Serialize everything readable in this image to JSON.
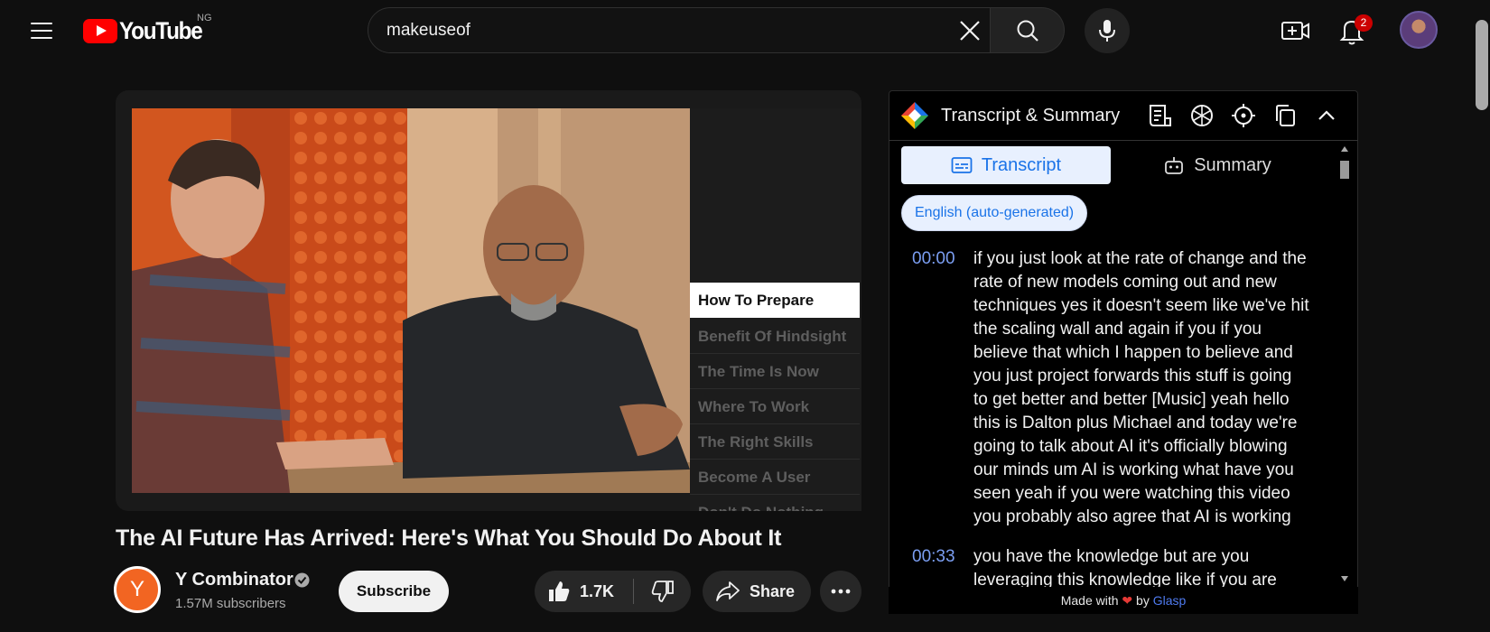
{
  "topbar": {
    "logo_text": "YouTube",
    "country_code": "NG",
    "search_value": "makeuseof",
    "notification_count": "2"
  },
  "video": {
    "title": "The AI Future Has Arrived: Here's What You Should Do About It",
    "chapters": [
      {
        "label": "How To Prepare",
        "active": true
      },
      {
        "label": "Benefit Of Hindsight",
        "active": false
      },
      {
        "label": "The Time Is Now",
        "active": false
      },
      {
        "label": "Where To Work",
        "active": false
      },
      {
        "label": "The Right Skills",
        "active": false
      },
      {
        "label": "Become A User",
        "active": false
      },
      {
        "label": "Don't Do Nothing",
        "active": false
      }
    ]
  },
  "channel": {
    "name": "Y Combinator",
    "avatar_letter": "Y",
    "subscribers": "1.57M subscribers",
    "subscribe_label": "Subscribe"
  },
  "actions": {
    "likes": "1.7K",
    "share_label": "Share"
  },
  "transcript_panel": {
    "title": "Transcript & Summary",
    "tab_transcript": "Transcript",
    "tab_summary": "Summary",
    "language": "English (auto-generated)",
    "segments": [
      {
        "time": "00:00",
        "lines": [
          "if you just look at the rate of change and the",
          "rate of new models coming out and new",
          "techniques yes it doesn't seem like we've hit",
          "the scaling wall and again if you if you",
          "believe that which I happen to believe and",
          "you just project forwards this stuff is going",
          "to get better and better [Music] yeah hello",
          "this is Dalton plus Michael and today we're",
          "going to talk about AI it's officially blowing",
          "our minds um AI is working what have you",
          "seen yeah if you were watching this video",
          "you probably also agree that AI is working"
        ]
      },
      {
        "time": "00:33",
        "lines": [
          "you have the knowledge but are you",
          "leveraging this knowledge like if you are"
        ]
      }
    ],
    "footer_made_with": "Made with",
    "footer_by": "by",
    "footer_brand": "Glasp"
  },
  "colors": {
    "youtube_red": "#ff0000",
    "link_blue": "#1a73e8",
    "timestamp_blue": "#7b9ef2",
    "background": "#0f0f0f"
  }
}
